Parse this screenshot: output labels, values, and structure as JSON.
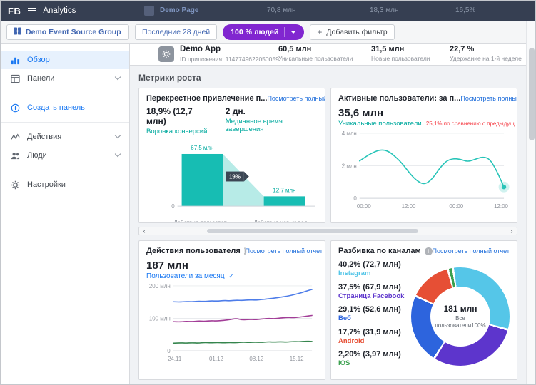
{
  "colors": {
    "header_bg": "#363f52",
    "accent_blue": "#1877f2",
    "link_blue": "#216fdb",
    "teal": "#00a99e",
    "red": "#f53b43",
    "purple": "#8126d0"
  },
  "icons": {
    "info": "i",
    "check": "✓",
    "plus": "+",
    "chevron_left": "‹",
    "chevron_right": "›"
  },
  "header": {
    "logo": "FB",
    "title": "Analytics",
    "ghost_row": {
      "name": "Demo Page",
      "values": [
        "70,8 млн",
        "18,3 млн",
        "16,5%"
      ]
    }
  },
  "toolbar": {
    "entity_selector": {
      "label": "Demo Event Source Group"
    },
    "date_range": {
      "label": "Последние 28 дней"
    },
    "percent_filter": {
      "label": "100 % людей"
    },
    "add_filter": {
      "label": "Добавить фильтр"
    }
  },
  "sidebar": {
    "items": [
      {
        "label": "Обзор"
      },
      {
        "label": "Панели"
      },
      {
        "label": "Создать панель"
      },
      {
        "label": "Действия"
      },
      {
        "label": "Люди"
      },
      {
        "label": "Настройки"
      }
    ]
  },
  "app_row": {
    "name": "Demo App",
    "id_line": "ID приложения: 1147749622050059",
    "metrics": [
      {
        "value": "60,5 млн",
        "label": "Уникальные пользователи"
      },
      {
        "value": "31,5 млн",
        "label": "Новые пользователи"
      },
      {
        "value": "22,7 %",
        "label": "Удержание на 1-й неделе"
      }
    ]
  },
  "section_title": "Метрики роста",
  "cards": {
    "funnel": {
      "title": "Перекрестное привлечение п...",
      "link": "Посмотреть полный отчет",
      "stat1_value": "18,9% (12,7 млн)",
      "stat1_label": "Воронка конверсий",
      "stat2_value": "2 дн.",
      "stat2_label": "Медианное время завершения"
    },
    "active": {
      "title": "Активные пользователи: за п...",
      "link": "Посмотреть полный отчет",
      "value": "35,6 млн",
      "label": "Уникальные пользователи",
      "change": "↓ 25,1% по сравнению с предыдущ..."
    },
    "actions": {
      "title": "Действия пользователя",
      "link": "Посмотреть полный отчет",
      "value": "187 млн",
      "filter": "Пользователи за месяц"
    },
    "channels": {
      "title": "Разбивка по каналам",
      "link": "Посмотреть полный отчет"
    }
  },
  "chart_data": [
    {
      "id": "funnel",
      "type": "bar",
      "title": "Перекрестное привлечение: воронка конверсий",
      "steps": [
        {
          "label": "Действия пользоват...",
          "value": 67.5,
          "value_label": "67,5 млн"
        },
        {
          "label": "Действия новых поль...",
          "value": 12.7,
          "value_label": "12,7 млн"
        }
      ],
      "conversion_label": "19%",
      "ymax": 75,
      "ylabel_zero": "0",
      "color": "#17bdb3",
      "light_color": "#b7ebe7",
      "value_color": "#00a99e",
      "badge_color": "#3c4654"
    },
    {
      "id": "active-users",
      "type": "line",
      "title": "Активные пользователи",
      "x_ticks": [
        "00:00",
        "12:00",
        "00:00",
        "12:00"
      ],
      "x_tick_fracs": [
        0.03,
        0.34,
        0.67,
        0.98
      ],
      "y_ticks": [
        "4 млн",
        "2 млн",
        "0"
      ],
      "ylim": [
        0,
        4
      ],
      "pad_left": 30,
      "endpoint_marker": true,
      "series": [
        {
          "name": "Уникальные пользователи",
          "color": "#27c4b8",
          "values": [
            2.3,
            2.6,
            2.85,
            3.0,
            2.9,
            2.55,
            2.1,
            1.5,
            1.05,
            0.85,
            1.15,
            1.8,
            2.3,
            2.45,
            2.4,
            2.25,
            2.4,
            2.55,
            2.45,
            1.7,
            0.7
          ]
        }
      ]
    },
    {
      "id": "user-actions",
      "type": "line",
      "title": "Действия пользователя",
      "x_ticks": [
        "24.11",
        "01.12",
        "08.12",
        "15.12"
      ],
      "x_tick_fracs": [
        0.01,
        0.31,
        0.6,
        0.89
      ],
      "y_ticks": [
        "200 млн",
        "100 млн",
        "0"
      ],
      "ylim": [
        0,
        200
      ],
      "pad_left": 38,
      "endpoint_marker": false,
      "series": [
        {
          "name": "series-blue",
          "color": "#4e7de9",
          "values": [
            151,
            150,
            152,
            151,
            153,
            152,
            154,
            153,
            155,
            154,
            156,
            155,
            157,
            156,
            158,
            160,
            162,
            165,
            168,
            172,
            177,
            183,
            189
          ]
        },
        {
          "name": "series-purple",
          "color": "#a23d97",
          "values": [
            90,
            89,
            91,
            90,
            92,
            91,
            93,
            92,
            94,
            96,
            100,
            95,
            97,
            96,
            98,
            100,
            99,
            101,
            103,
            102,
            104,
            106,
            109
          ]
        },
        {
          "name": "series-green",
          "color": "#35854d",
          "values": [
            24,
            25,
            24,
            25,
            24,
            26,
            25,
            26,
            25,
            26,
            25,
            27,
            26,
            27,
            26,
            28,
            27,
            28,
            27,
            29,
            28,
            30,
            29
          ]
        }
      ]
    },
    {
      "id": "channels",
      "type": "pie",
      "title": "Разбивка по каналам",
      "center_value": "181 млн",
      "center_label": "Все пользователи100%",
      "segments": [
        {
          "name": "Instagram",
          "percent_label": "40,2% (72,7 млн)",
          "share": 31.7,
          "color": "#55c6e8"
        },
        {
          "name": "Страница Facebook",
          "percent_label": "37,5% (67,9 млн)",
          "share": 29.6,
          "color": "#5d35cc"
        },
        {
          "name": "Веб",
          "percent_label": "29,1% (52,6 млн)",
          "share": 23.0,
          "color": "#2d64dd"
        },
        {
          "name": "Android",
          "percent_label": "17,7% (31,9 млн)",
          "share": 14.0,
          "color": "#e64f35"
        },
        {
          "name": "iOS",
          "percent_label": "2,20% (3,97 млн)",
          "share": 1.7,
          "color": "#3aa04e"
        }
      ]
    }
  ]
}
